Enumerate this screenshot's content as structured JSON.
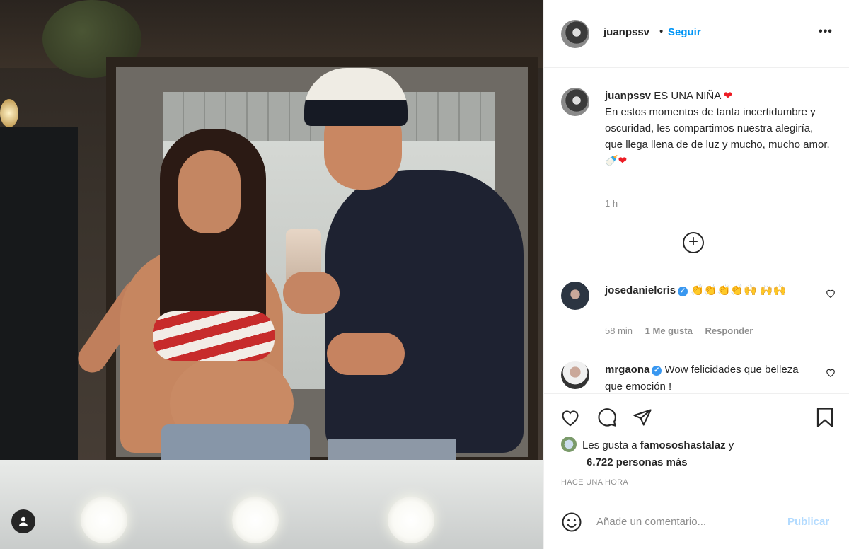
{
  "post": {
    "username": "juanpssv",
    "separator": "•",
    "follow_label": "Seguir",
    "more_label": "•••",
    "caption": {
      "title": "ES UNA NIÑA",
      "title_emoji": "❤",
      "body": "En estos momentos de tanta incertidumbre y oscuridad, les compartimos nuestra alegiría, que llega llena de de luz y mucho, mucho amor.",
      "end_emoji": "🍼❤",
      "time": "1 h"
    },
    "load_more_label": "+"
  },
  "comments": [
    {
      "username": "josedanielcris",
      "verified": true,
      "text": "👏👏👏👏🙌 🙌🙌",
      "time": "58 min",
      "likes": "1 Me gusta",
      "reply": "Responder"
    },
    {
      "username": "mrgaona",
      "verified": true,
      "text": "Wow felicidades que belleza que emoción !"
    }
  ],
  "actions": {
    "liked_by_prefix": "Les gusta a",
    "liked_by_user": "famososhastalaz",
    "liked_by_conj": "y",
    "others_count": "6.722 personas más",
    "posted_ago": "HACE UNA HORA"
  },
  "composer": {
    "placeholder": "Añade un comentario...",
    "publish_label": "Publicar"
  },
  "colors": {
    "link_blue": "#0095f6",
    "verified_blue": "#3897f0",
    "heart_red": "#ed1c24",
    "publish_disabled": "#b3dbff"
  }
}
